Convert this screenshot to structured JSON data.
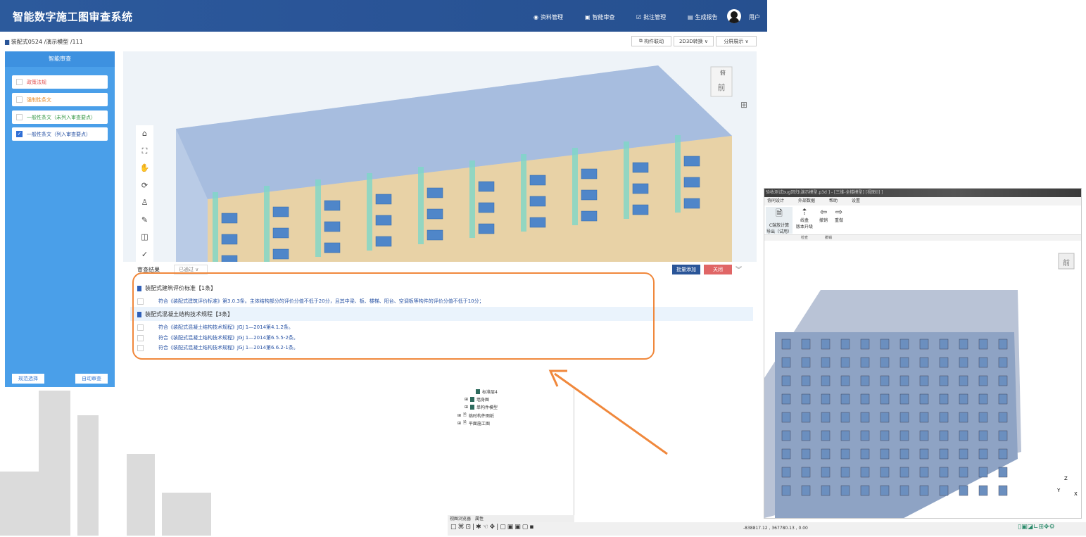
{
  "header": {
    "title": "智能数字施工图审查系统",
    "nav": [
      {
        "icon": "database-icon",
        "label": "资料管理"
      },
      {
        "icon": "monitor-icon",
        "label": "智能审查"
      },
      {
        "icon": "edit-icon",
        "label": "批注管理"
      },
      {
        "icon": "report-icon",
        "label": "生成报告"
      }
    ],
    "user": "用户"
  },
  "breadcrumb": "装配式0524 /演示模型 /111",
  "toolbar": {
    "link": "构件联动",
    "convert": "2D3D转换",
    "split": "分屏展示"
  },
  "left_panel": {
    "title": "智能审查",
    "items": [
      {
        "label": "政策法规",
        "checked": false,
        "color": "#e04b4b"
      },
      {
        "label": "强制性条文",
        "checked": false,
        "color": "#e58a2a"
      },
      {
        "label": "一般性条文（未列入审查要点）",
        "checked": false,
        "color": "#3a9a4a"
      },
      {
        "label": "一般性条文（列入审查要点）",
        "checked": true,
        "color": "#2b55a5"
      }
    ],
    "btn_select": "规范选择",
    "btn_auto": "自动审查"
  },
  "viewcube": {
    "top": "俯",
    "front": "前"
  },
  "results": {
    "label": "审查结果",
    "filter": "已通过",
    "batch_add": "批量添加",
    "close": "关闭",
    "groups": [
      {
        "title": "装配式建筑评价标准【1条】",
        "rows": [
          "符合《装配式建筑评价标准》第3.0.3条。主体结构部分的评价分值不低于20分，且其中梁、板、楼梯、阳台、空调板等构件的评价分值不低于10分；"
        ]
      },
      {
        "title": "装配式混凝土结构技术规程【3条】",
        "rows": [
          "符合《装配式混凝土结构技术规程》JGJ 1—2014第4.1.2条。",
          "符合《装配式混凝土结构技术规程》JGJ 1—2014第6.5.5-2条。",
          "符合《装配式混凝土结构技术规程》JGJ 1—2014第6.6.2-1条。"
        ]
      }
    ]
  },
  "desktop": {
    "titlebar": "验收测试bug回归\\演示模型.p3d ] - [三维-全楼模型] [视图0] ]",
    "menu": [
      "协同设计",
      "外部数据",
      "帮助",
      "设置"
    ],
    "ribbon": [
      {
        "label1": "C端放计算",
        "label2": "导出（试用）"
      },
      {
        "label1": "线盒",
        "label2": "版本升级"
      },
      {
        "label1": "撤销"
      },
      {
        "label1": "重做"
      }
    ],
    "ribbon_groups": [
      "检查",
      "撤销"
    ],
    "tree": [
      "标准层4",
      "墙身图",
      "单构件模型",
      "临时构件图纸",
      "平面施工图"
    ],
    "tabs": [
      "视图浏览器",
      "属性"
    ],
    "coords": "-838817.12 , 367780.13 , 0.00",
    "viewcube_front": "前",
    "axes": [
      "Z",
      "Y",
      "X"
    ]
  },
  "colors": {
    "accent": "#2a5598",
    "highlight": "#f0883c",
    "close": "#e06666"
  }
}
